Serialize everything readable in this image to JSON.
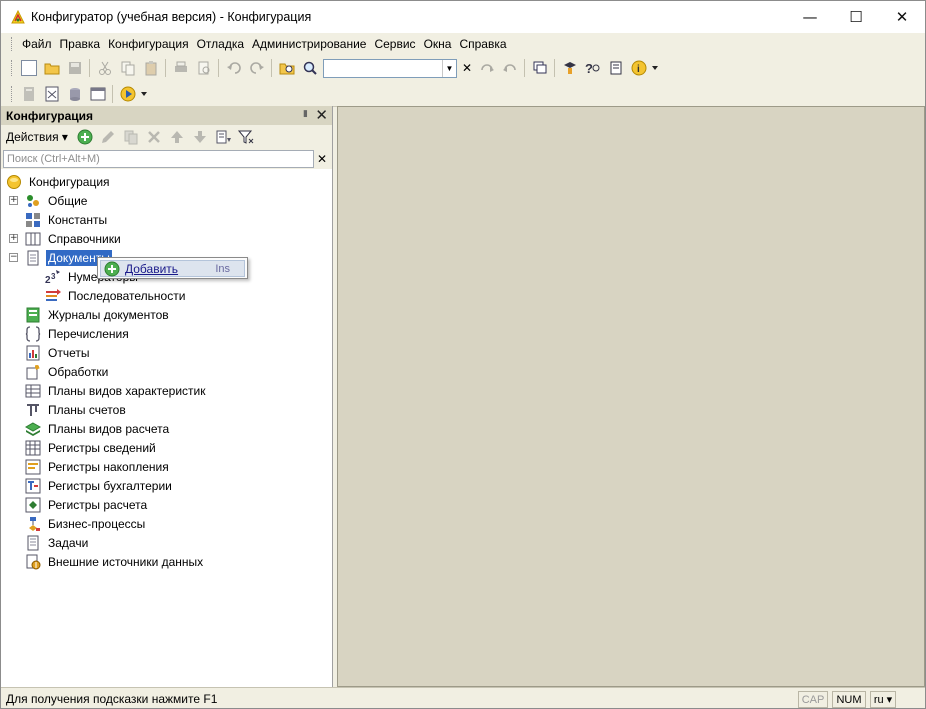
{
  "window": {
    "title": "Конфигуратор (учебная версия) - Конфигурация",
    "min_glyph": "—",
    "max_glyph": "☐",
    "close_glyph": "✕"
  },
  "menu": {
    "items": [
      "Файл",
      "Правка",
      "Конфигурация",
      "Отладка",
      "Администрирование",
      "Сервис",
      "Окна",
      "Справка"
    ]
  },
  "toolbar": {
    "search_value": "",
    "clear_glyph": "✕",
    "info_glyph": "i"
  },
  "panel": {
    "title": "Конфигурация",
    "close_glyph": "✕",
    "pin_glyph": "▮",
    "actions_label": "Действия ▾",
    "search_placeholder": "Поиск (Ctrl+Alt+M)",
    "search_clear_glyph": "✕"
  },
  "tree": {
    "root": "Конфигурация",
    "items": [
      {
        "label": "Общие",
        "icon": "common-icon",
        "expander": "+"
      },
      {
        "label": "Константы",
        "icon": "constants-icon",
        "expander": ""
      },
      {
        "label": "Справочники",
        "icon": "catalogs-icon",
        "expander": "+"
      },
      {
        "label": "Документы",
        "icon": "documents-icon",
        "expander": "−"
      },
      {
        "label": "Нумераторы",
        "icon": "numerators-icon",
        "expander": ""
      },
      {
        "label": "Последовательности",
        "icon": "sequences-icon",
        "expander": ""
      },
      {
        "label": "Журналы документов",
        "icon": "journals-icon",
        "expander": ""
      },
      {
        "label": "Перечисления",
        "icon": "enums-icon",
        "expander": ""
      },
      {
        "label": "Отчеты",
        "icon": "reports-icon",
        "expander": ""
      },
      {
        "label": "Обработки",
        "icon": "dataprocessors-icon",
        "expander": ""
      },
      {
        "label": "Планы видов характеристик",
        "icon": "chart-of-characteristics-icon",
        "expander": ""
      },
      {
        "label": "Планы счетов",
        "icon": "chart-of-accounts-icon",
        "expander": ""
      },
      {
        "label": "Планы видов расчета",
        "icon": "chart-of-calc-icon",
        "expander": ""
      },
      {
        "label": "Регистры сведений",
        "icon": "info-registers-icon",
        "expander": ""
      },
      {
        "label": "Регистры накопления",
        "icon": "accum-registers-icon",
        "expander": ""
      },
      {
        "label": "Регистры бухгалтерии",
        "icon": "accounting-registers-icon",
        "expander": ""
      },
      {
        "label": "Регистры расчета",
        "icon": "calc-registers-icon",
        "expander": ""
      },
      {
        "label": "Бизнес-процессы",
        "icon": "business-process-icon",
        "expander": ""
      },
      {
        "label": "Задачи",
        "icon": "tasks-icon",
        "expander": ""
      },
      {
        "label": "Внешние источники данных",
        "icon": "external-sources-icon",
        "expander": ""
      }
    ]
  },
  "context_menu": {
    "add_label": "Добавить",
    "add_shortcut": "Ins"
  },
  "status": {
    "hint": "Для получения подсказки нажмите F1",
    "cap": "CAP",
    "num": "NUM",
    "lang": "ru ▾"
  },
  "colors": {
    "selection": "#316ac5",
    "chrome": "#f1efe2",
    "workspace": "#d8d4c2"
  }
}
